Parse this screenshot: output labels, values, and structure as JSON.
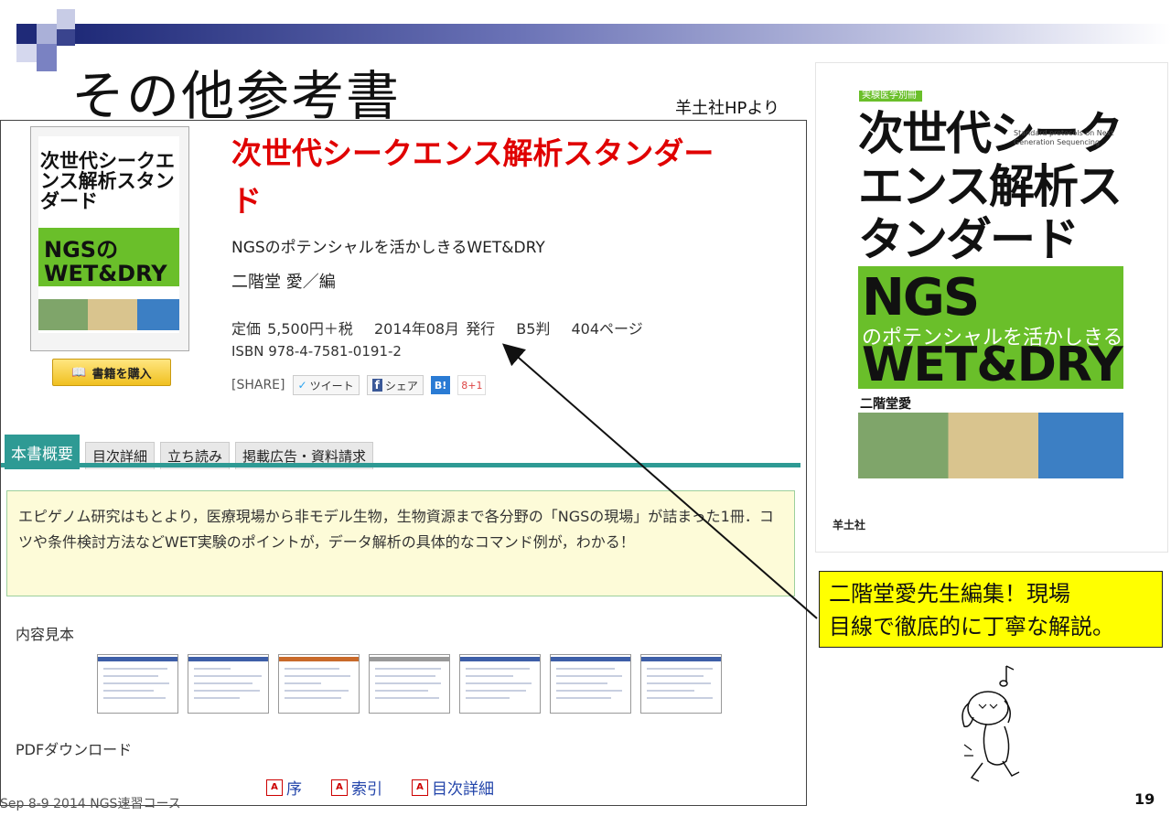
{
  "slide": {
    "title": "その他参考書",
    "source_note": "羊土社HPより",
    "footer_text": "Sep 8-9 2014 NGS速習コース",
    "slide_number": "19",
    "accent_color": "#1f2a78"
  },
  "web_page": {
    "cover_small": {
      "title_line": "次世代シークエンス解析スタンダード",
      "ngs": "NGSの",
      "wetdry": "WET&DRY"
    },
    "buy_button": "書籍を購入",
    "book_title": "次世代シークエンス解析スタンダード",
    "subtitle": "NGSのポテンシャルを活かしきるWET&DRY",
    "editor": "二階堂 愛／編",
    "price_line": "定価 5,500円＋税　 2014年08月 発行 　B5判 　404ページ",
    "isbn": "ISBN 978-4-7581-0191-2",
    "share": {
      "label": "[SHARE]",
      "tweet": "ツイート",
      "fb_share": "シェア",
      "hatena": "B!",
      "gplus": "8+1"
    },
    "tabs": [
      {
        "label": "本書概要",
        "active": true
      },
      {
        "label": "目次詳細",
        "active": false
      },
      {
        "label": "立ち読み",
        "active": false
      },
      {
        "label": "掲載広告・資料請求",
        "active": false
      }
    ],
    "tab_color": "#2e9a94",
    "summary": "エピゲノム研究はもとより，医療現場から非モデル生物，生物資源まで各分野の「NGSの現場」が詰まった1冊．コツや条件検討方法などWET実験のポイントが，データ解析の具体的なコマンド例が，わかる！",
    "sample_label": "内容見本",
    "thumbnails": [
      "sample-page-1",
      "sample-page-2",
      "sample-page-3",
      "sample-page-4",
      "sample-page-5",
      "sample-page-6",
      "sample-page-7"
    ],
    "pdf_label": "PDFダウンロード",
    "pdf_links": [
      "序",
      "索引",
      "目次詳細"
    ]
  },
  "cover_large": {
    "band": "実験医学別冊",
    "title": "次世代シークエンス解析スタンダード",
    "english": "Standard protocols on Next Generation Sequencing",
    "ngs": "NGS",
    "ngs_sub": "のポテンシャルを活かしきる",
    "wetdry": "WET&DRY",
    "author": "二階堂愛",
    "publisher": "羊土社"
  },
  "callout": {
    "line1": "二階堂愛先生編集！現場",
    "line2": "目線で徹底的に丁寧な解説。",
    "color": "#ffff00"
  }
}
